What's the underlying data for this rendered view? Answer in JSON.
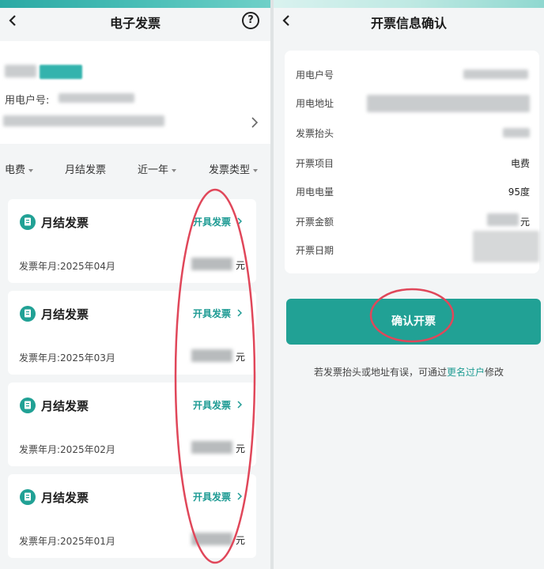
{
  "left": {
    "nav": {
      "title": "电子发票",
      "help_glyph": "?"
    },
    "account": {
      "user_no_label": "用电户号:"
    },
    "filters": [
      {
        "label": "电费"
      },
      {
        "label": "月结发票"
      },
      {
        "label": "近一年"
      },
      {
        "label": "发票类型"
      }
    ],
    "invoices": [
      {
        "title": "月结发票",
        "action": "开具发票",
        "date": "发票年月:2025年04月",
        "unit": "元"
      },
      {
        "title": "月结发票",
        "action": "开具发票",
        "date": "发票年月:2025年03月",
        "unit": "元"
      },
      {
        "title": "月结发票",
        "action": "开具发票",
        "date": "发票年月:2025年02月",
        "unit": "元"
      },
      {
        "title": "月结发票",
        "action": "开具发票",
        "date": "发票年月:2025年01月",
        "unit": "元"
      }
    ]
  },
  "right": {
    "nav": {
      "title": "开票信息确认"
    },
    "info": [
      {
        "label": "用电户号",
        "value": ""
      },
      {
        "label": "用电地址",
        "value": ""
      },
      {
        "label": "发票抬头",
        "value": ""
      },
      {
        "label": "开票项目",
        "value": "电费"
      },
      {
        "label": "用电电量",
        "value": "95度"
      },
      {
        "label": "开票金额",
        "value": "元"
      },
      {
        "label": "开票日期",
        "value": ""
      }
    ],
    "confirm_label": "确认开票",
    "notice": {
      "prefix": "若发票抬头或地址有误，可通过",
      "link": "更名过户",
      "suffix": "修改"
    }
  },
  "colors": {
    "accent": "#21a195",
    "link": "#1f9c93",
    "annotation": "#e0475a"
  }
}
